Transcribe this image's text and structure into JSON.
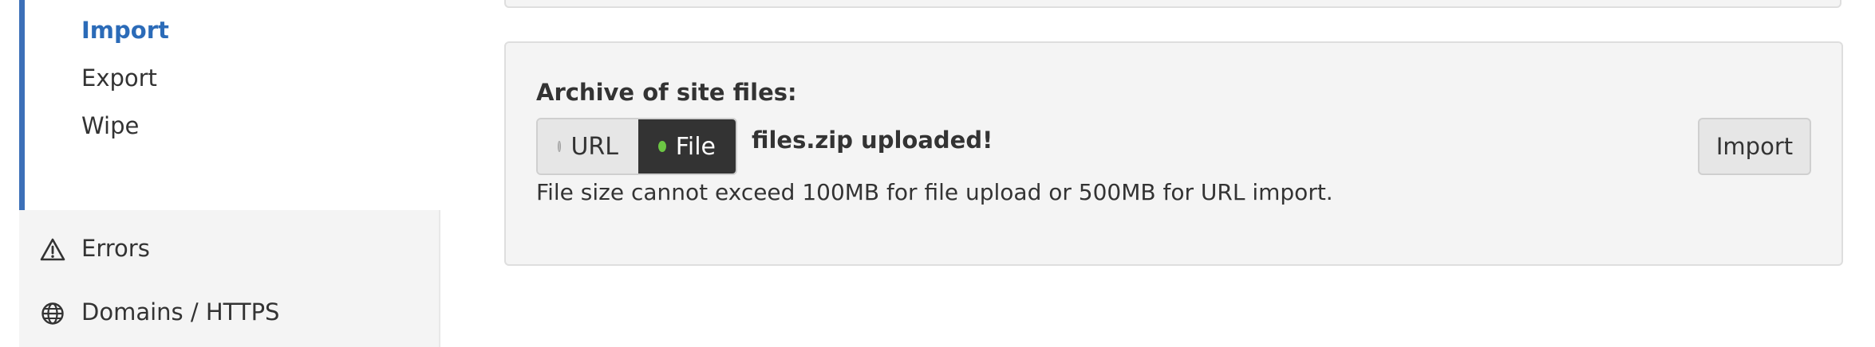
{
  "sidebar": {
    "sub_items": [
      {
        "label": "Import",
        "active": true
      },
      {
        "label": "Export",
        "active": false
      },
      {
        "label": "Wipe",
        "active": false
      }
    ],
    "main_items": [
      {
        "label": "Errors",
        "icon": "warning-icon"
      },
      {
        "label": "Domains / HTTPS",
        "icon": "globe-icon"
      }
    ]
  },
  "import_panel": {
    "label": "Archive of site files:",
    "toggle": {
      "options": [
        "URL",
        "File"
      ],
      "selected": "File"
    },
    "upload_status": "files.zip uploaded!",
    "hint": "File size cannot exceed 100MB for file upload or 500MB for URL import.",
    "import_button": "Import"
  },
  "colors": {
    "accent": "#3c70b8",
    "active_link": "#2b6bb8",
    "toggle_selected_bg": "#333333",
    "status_dot_on": "#6cc644",
    "panel_bg": "#f4f4f4"
  }
}
